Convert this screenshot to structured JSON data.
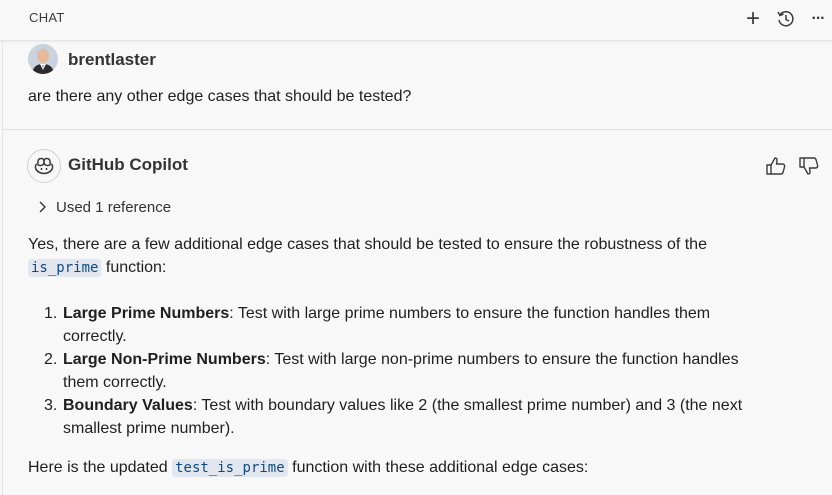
{
  "header": {
    "title": "CHAT",
    "actions": [
      {
        "name": "new-chat-icon",
        "glyph": "+"
      },
      {
        "name": "history-icon"
      },
      {
        "name": "more-icon",
        "glyph": "···"
      }
    ]
  },
  "user_message": {
    "author": "brentlaster",
    "text": "are there any other edge cases that should be tested?"
  },
  "assistant_message": {
    "author": "GitHub Copilot",
    "references_label": "Used 1 reference",
    "intro_part1": "Yes, there are a few additional edge cases that should be tested to ensure the robustness of the",
    "intro_code": "is_prime",
    "intro_part2": " function:",
    "list": [
      {
        "num": "1.",
        "title": "Large Prime Numbers",
        "line1": ": Test with large prime numbers to ensure the function handles them",
        "line2": "correctly."
      },
      {
        "num": "2.",
        "title": "Large Non-Prime Numbers",
        "line1": ": Test with large non-prime numbers to ensure the function handles",
        "line2": "them correctly."
      },
      {
        "num": "3.",
        "title": "Boundary Values",
        "line1": ": Test with boundary values like 2 (the smallest prime number) and 3 (the next",
        "line2": "smallest prime number)."
      }
    ],
    "outro_part1": "Here is the updated ",
    "outro_code": "test_is_prime",
    "outro_part2": " function with these additional edge cases:"
  }
}
